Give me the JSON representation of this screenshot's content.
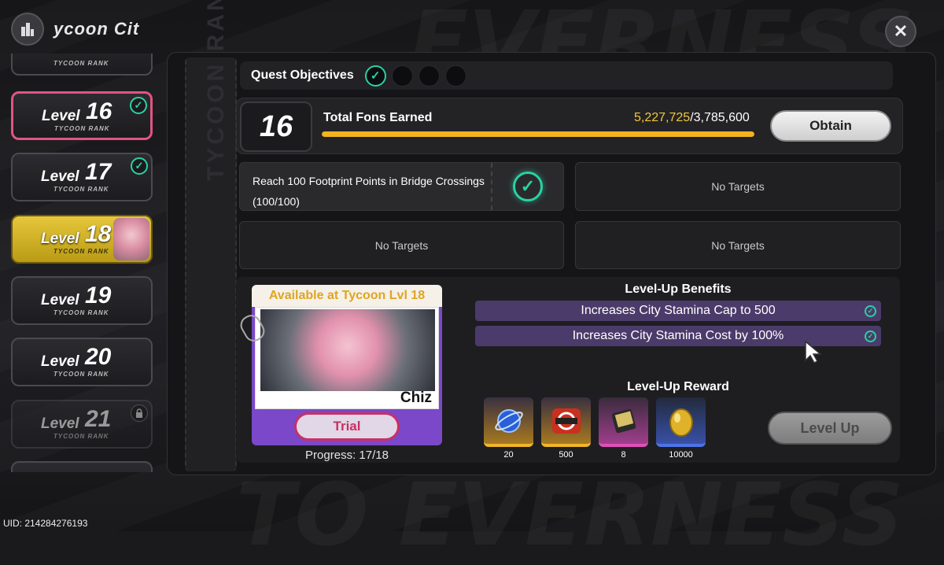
{
  "header": {
    "title": "ycoon  Cit"
  },
  "level_list": [
    {
      "word": "Level",
      "number": "16",
      "rank": "TYCOON RANK",
      "state": "completed"
    },
    {
      "word": "Level",
      "number": "17",
      "rank": "TYCOON RANK",
      "state": "completed"
    },
    {
      "word": "Level",
      "number": "18",
      "rank": "TYCOON RANK",
      "state": "current"
    },
    {
      "word": "Level",
      "number": "19",
      "rank": "TYCOON RANK",
      "state": "default"
    },
    {
      "word": "Level",
      "number": "20",
      "rank": "TYCOON RANK",
      "state": "default"
    },
    {
      "word": "Level",
      "number": "21",
      "rank": "TYCOON RANK",
      "state": "locked"
    }
  ],
  "top_partial_rank": "TYCOON RANK",
  "quest": {
    "label": "Quest Objectives",
    "completed": 1,
    "total": 4
  },
  "fons": {
    "level": "16",
    "label": "Total Fons Earned",
    "current": "5,227,725",
    "target": "/3,785,600",
    "progress_fraction": 1.0,
    "obtain_label": "Obtain"
  },
  "targets": [
    {
      "line1": "Reach 100 Footprint Points in Bridge Crossings",
      "line2": "(100/100)",
      "done": true
    },
    {
      "text": "No Targets"
    },
    {
      "text": "No Targets"
    },
    {
      "text": "No Targets"
    }
  ],
  "spine_text": "TYCOON RANK",
  "character": {
    "available_text": "Available at Tycoon Lvl 18",
    "name": "Chiz",
    "trial_label": "Trial",
    "progress_text": "Progress: 17/18"
  },
  "benefits": {
    "title": "Level-Up Benefits",
    "items": [
      "Increases City Stamina Cap to 500",
      "Increases City Stamina Cost by 100%"
    ]
  },
  "rewards": {
    "title": "Level-Up Reward",
    "items": [
      {
        "icon": "orb-icon",
        "count": "20",
        "rarity": "gold"
      },
      {
        "icon": "hunter-badge-icon",
        "count": "500",
        "rarity": "gold"
      },
      {
        "icon": "book-icon",
        "count": "8",
        "rarity": "pink"
      },
      {
        "icon": "egg-icon",
        "count": "10000",
        "rarity": "blue"
      }
    ]
  },
  "level_up_label": "Level Up",
  "uid_text": "UID: 214284276193",
  "colors": {
    "accent_green": "#2ad1a3",
    "progress_gold": "#f2b31e",
    "highlight_pink": "#e05583"
  }
}
